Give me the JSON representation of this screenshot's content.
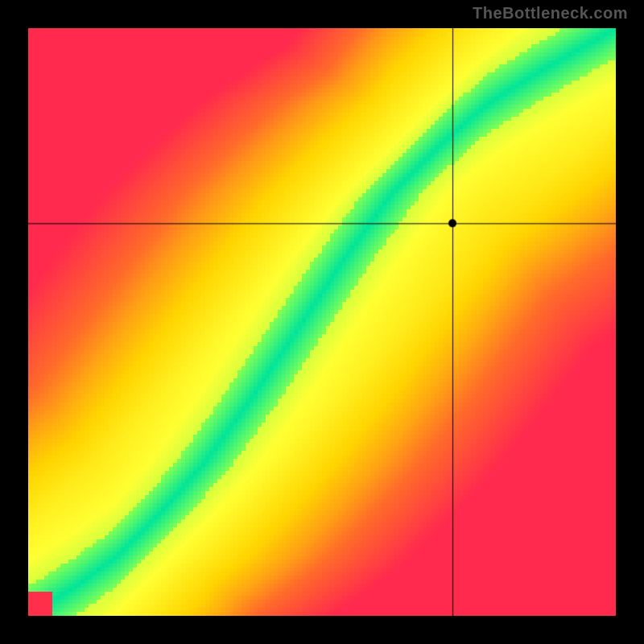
{
  "watermark": "TheBottleneck.com",
  "chart_data": {
    "type": "heatmap",
    "title": "",
    "xlabel": "",
    "ylabel": "",
    "xlim": [
      0,
      1
    ],
    "ylim": [
      0,
      1
    ],
    "crosshair": {
      "x": 0.722,
      "y": 0.668
    },
    "marker": {
      "x": 0.722,
      "y": 0.668
    },
    "ridge_curve": [
      [
        0.0,
        0.0
      ],
      [
        0.08,
        0.05
      ],
      [
        0.15,
        0.1
      ],
      [
        0.22,
        0.17
      ],
      [
        0.3,
        0.26
      ],
      [
        0.38,
        0.37
      ],
      [
        0.46,
        0.49
      ],
      [
        0.54,
        0.61
      ],
      [
        0.62,
        0.72
      ],
      [
        0.7,
        0.8
      ],
      [
        0.78,
        0.87
      ],
      [
        0.86,
        0.92
      ],
      [
        0.93,
        0.96
      ],
      [
        1.0,
        1.0
      ]
    ],
    "ridge_half_width": 0.05,
    "colorscale": [
      [
        0.0,
        "#ff2a4d"
      ],
      [
        0.25,
        "#ff6a2a"
      ],
      [
        0.5,
        "#ffd500"
      ],
      [
        0.7,
        "#ffff33"
      ],
      [
        0.85,
        "#7fff55"
      ],
      [
        1.0,
        "#00e59a"
      ]
    ]
  }
}
